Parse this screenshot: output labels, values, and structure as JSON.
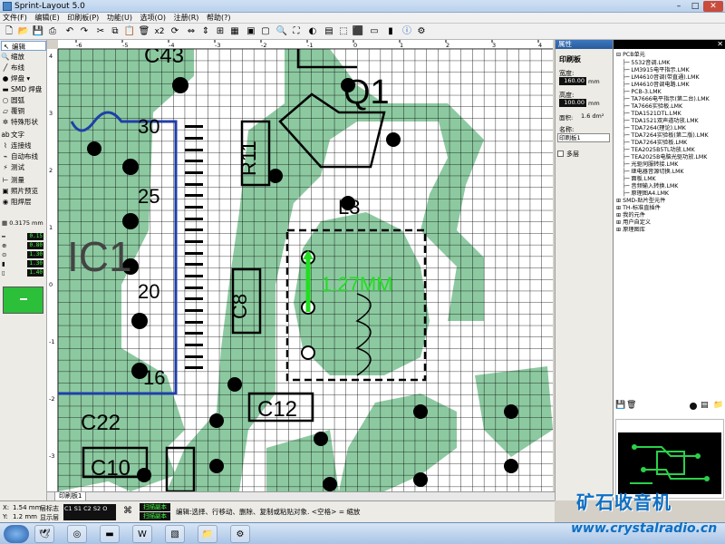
{
  "window": {
    "title": "Sprint-Layout 5.0",
    "minimize": "–",
    "maximize": "□",
    "close": "✕"
  },
  "menu": [
    "文件(F)",
    "编辑(E)",
    "印刷板(P)",
    "功能(U)",
    "选项(O)",
    "注册(R)",
    "帮助(?)"
  ],
  "toolbar": {
    "zoom_factor": "x2"
  },
  "tools": [
    {
      "label": "编辑",
      "icon": "arrow-cursor-icon",
      "glyph": "↖"
    },
    {
      "label": "缩放",
      "icon": "zoom-icon",
      "glyph": "🔍"
    },
    {
      "label": "布线",
      "icon": "track-icon",
      "glyph": "╱"
    },
    {
      "label": "焊盘",
      "icon": "pad-icon",
      "glyph": "●"
    },
    {
      "label": "SMD 焊盘",
      "icon": "smd-pad-icon",
      "glyph": "▬"
    },
    {
      "label": "圆弧",
      "icon": "circle-icon",
      "glyph": "○"
    },
    {
      "label": "覆铜",
      "icon": "polygon-icon",
      "glyph": "▱"
    },
    {
      "label": "特殊形状",
      "icon": "special-shape-icon",
      "glyph": "✲"
    },
    {
      "label": "文字",
      "icon": "text-icon",
      "glyph": "ab"
    },
    {
      "label": "连接线",
      "icon": "connection-icon",
      "glyph": "⌇"
    },
    {
      "label": "自动布线",
      "icon": "autoroute-icon",
      "glyph": "⌁"
    },
    {
      "label": "测试",
      "icon": "test-icon",
      "glyph": "⚡"
    },
    {
      "label": "测量",
      "icon": "measure-icon",
      "glyph": "⊢"
    },
    {
      "label": "照片预览",
      "icon": "photo-icon",
      "glyph": "▣"
    },
    {
      "label": "阻焊层",
      "icon": "mask-icon",
      "glyph": "◉"
    }
  ],
  "grid": {
    "value": "0.3175 mm"
  },
  "dimensions": [
    "0.15",
    "0.80",
    "1.30",
    "1.30",
    "1.40"
  ],
  "ruler_top": [
    "-6",
    "-5",
    "-4",
    "-3",
    "-2",
    "-1",
    "0",
    "1",
    "2",
    "3",
    "4"
  ],
  "ruler_left": [
    "4",
    "3",
    "2",
    "1",
    "0",
    "-1",
    "-2",
    "-3"
  ],
  "canvas": {
    "labels": {
      "c43": "C43",
      "q1": "Q1",
      "r11": "R11",
      "l3": "L3",
      "ic1": "IC1",
      "c8": "C8",
      "c12": "C12",
      "c22": "C22",
      "c10": "C10",
      "pin30": "30",
      "pin25": "25",
      "pin20": "20",
      "pin16": "16",
      "measure": "1.27MM"
    }
  },
  "tab": {
    "label": "印刷板1"
  },
  "props": {
    "title": "属性",
    "section": "印刷板",
    "width_label": "宽度:",
    "width_value": "160.00",
    "width_unit": "mm",
    "height_label": "高度:",
    "height_value": "100.00",
    "height_unit": "mm",
    "area_label": "面积:",
    "area_value": "1.6 dm²",
    "name_label": "名称:",
    "name_value": "印刷板1",
    "multilayer_label": "多层"
  },
  "library": {
    "root": "PCB单元",
    "items": [
      "5532音调.LMK",
      "LM3915电平指示.LMK",
      "LM4610音调(带直通).LMK",
      "LM4610音调电路.LMK",
      "PCB-3.LMK",
      "TA7666电平指示(第二台).LMK",
      "TA7666实验板.LMK",
      "TDA1521DTL.LMK",
      "TDA1521双声道功放.LMK",
      "TDA7264(理论).LMK",
      "TDA7264实验板(第二版).LMK",
      "TDA7264实验板.LMK",
      "TEA2025B5TL功放.LMK",
      "TEA2025B电脑光驱功放.LMK",
      "光驱伺服转接.LMK",
      "继电器音源切换.LMK",
      "面板.LMK",
      "音频输入转换.LMK",
      "原理图A4.LMK"
    ],
    "groups": [
      "SMD-贴片型元件",
      "TH-标准直插件",
      "我的元件",
      "用户自定义",
      "原理图库"
    ]
  },
  "status": {
    "x_label": "X:",
    "x_value": "1.54 mm",
    "y_label": "Y:",
    "y_value": "1.2 mm",
    "flag1": "层标志",
    "flag2": "显示层",
    "layers": [
      "C1",
      "S1",
      "C2",
      "S2",
      "O"
    ],
    "mode1": "扫描副本",
    "mode2": "扫描副本",
    "help": "编辑:选择、行移动、删除、复制或粘贴对象. <空格> = 缩放"
  },
  "watermark": {
    "cn": "矿石收音机",
    "url": "www.crystalradio.cn"
  },
  "colors": {
    "copper": "#8cc9a0",
    "grid": "#000000",
    "board_outline": "#1f3fa8",
    "measure": "#22dd22"
  }
}
